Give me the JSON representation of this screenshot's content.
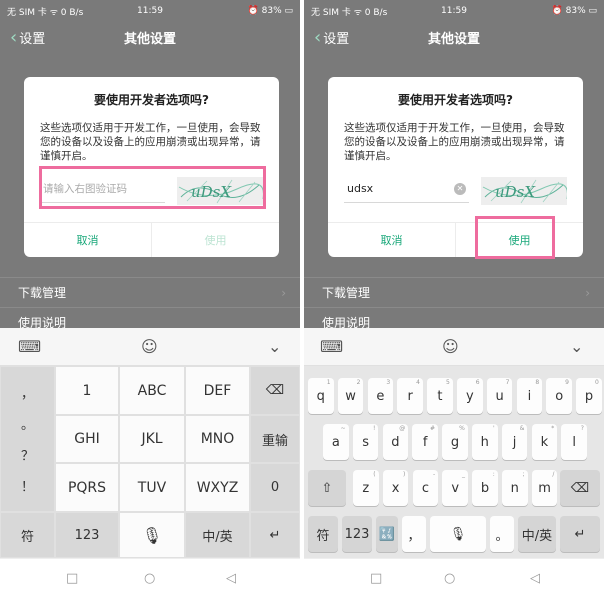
{
  "status": {
    "left": "无 SIM 卡 ᯤ 0 B/s",
    "time": "11:59",
    "right": "⏰ 83% ▭"
  },
  "titlebar": {
    "back": "设置",
    "title": "其他设置"
  },
  "settings_rows": [
    "下载管理",
    "使用说明"
  ],
  "dialog": {
    "title": "要使用开发者选项吗?",
    "message": "这些选项仅适用于开发工作，一旦使用，会导致您的设备以及设备上的应用崩溃或出现异常，请谨慎开启。",
    "placeholder": "请输入右图验证码",
    "typed_value": "udsx",
    "captcha_text": "uDsX",
    "cancel": "取消",
    "confirm": "使用"
  },
  "keyboard9": {
    "symbols": [
      "，",
      "。",
      "？",
      "！"
    ],
    "row1": [
      "1",
      "ABC",
      "DEF"
    ],
    "row2": [
      "GHI",
      "JKL",
      "MNO"
    ],
    "row3": [
      "PQRS",
      "TUV",
      "WXYZ"
    ],
    "retype": "重输",
    "zero": "0",
    "fu": "符",
    "num": "123",
    "lang": "中/英"
  },
  "keyboard26": {
    "row1": [
      [
        "q",
        "1"
      ],
      [
        "w",
        "2"
      ],
      [
        "e",
        "3"
      ],
      [
        "r",
        "4"
      ],
      [
        "t",
        "5"
      ],
      [
        "y",
        "6"
      ],
      [
        "u",
        "7"
      ],
      [
        "i",
        "8"
      ],
      [
        "o",
        "9"
      ],
      [
        "p",
        "0"
      ]
    ],
    "row2": [
      [
        "a",
        "~"
      ],
      [
        "s",
        "!"
      ],
      [
        "d",
        "@"
      ],
      [
        "f",
        "#"
      ],
      [
        "g",
        "%"
      ],
      [
        "h",
        "'"
      ],
      [
        "j",
        "&"
      ],
      [
        "k",
        "*"
      ],
      [
        "l",
        "?"
      ]
    ],
    "row3": [
      [
        "z",
        "("
      ],
      [
        "x",
        ")"
      ],
      [
        "c",
        "-"
      ],
      [
        "v",
        "_"
      ],
      [
        "b",
        ":"
      ],
      [
        "n",
        ";"
      ],
      [
        "m",
        "/"
      ]
    ],
    "fu": "符",
    "num": "123",
    "lang": "中/英",
    "comma": "，",
    "period": "。"
  },
  "colors": {
    "accent": "#1aa87a",
    "highlight": "#ee6c9e",
    "dim": "#7a7a7a"
  }
}
